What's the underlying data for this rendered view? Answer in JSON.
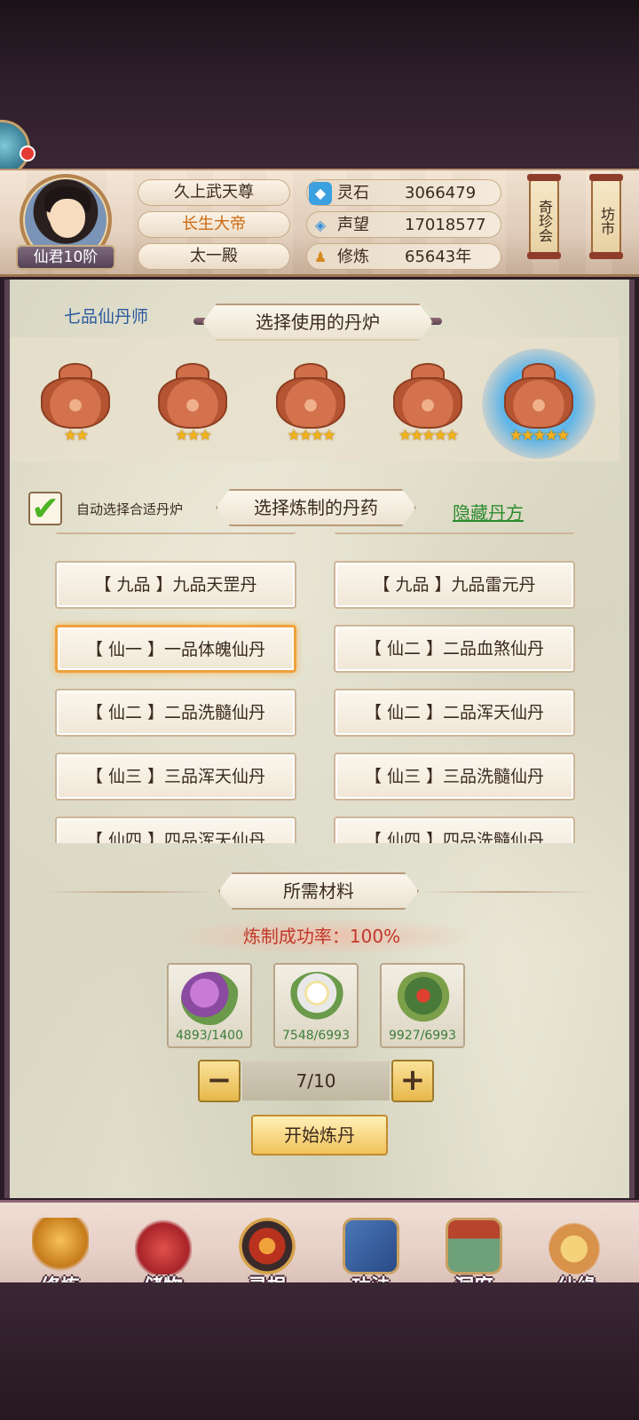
{
  "header": {
    "rank_badge": "仙君10阶",
    "titles": [
      "久上武天尊",
      "长生大帝",
      "太一殿"
    ],
    "stats": [
      {
        "icon": "spirit-stone-icon",
        "label": "灵石",
        "value": "3066479"
      },
      {
        "icon": "prestige-icon",
        "label": "声望",
        "value": "17018577"
      },
      {
        "icon": "cultivation-icon",
        "label": "修炼",
        "value": "65643年"
      }
    ],
    "lanterns": [
      "奇珍会",
      "坊市"
    ]
  },
  "panel": {
    "rank_title": "七品仙丹师",
    "furnace_banner": "选择使用的丹炉",
    "furnaces": [
      {
        "stars": "★★"
      },
      {
        "stars": "★★★"
      },
      {
        "stars": "★★★★"
      },
      {
        "stars": "★★★★★"
      },
      {
        "stars": "★★★★★"
      }
    ],
    "auto_select_label": "自动选择合适丹炉",
    "auto_select_checked": "✔",
    "pill_banner": "选择炼制的丹药",
    "hide_recipe": "隐藏丹方",
    "pills": [
      [
        "【 九品 】九品天罡丹",
        "【 九品 】九品雷元丹"
      ],
      [
        "【 仙一 】一品体魄仙丹",
        "【 仙二 】二品血煞仙丹"
      ],
      [
        "【 仙二 】二品洗髓仙丹",
        "【 仙二 】二品浑天仙丹"
      ],
      [
        "【 仙三 】三品浑天仙丹",
        "【 仙三 】三品洗髓仙丹"
      ],
      [
        "【 仙四 】四品浑天仙丹",
        "【 仙四 】四品洗髓仙丹"
      ]
    ],
    "materials_banner": "所需材料",
    "success_rate": "炼制成功率：100%",
    "materials": [
      {
        "icon": "purple-herb-icon",
        "count": "4893/1400"
      },
      {
        "icon": "white-lily-icon",
        "count": "7548/6993"
      },
      {
        "icon": "red-flower-herb-icon",
        "count": "9927/6993"
      }
    ],
    "quantity": "7/10",
    "minus": "−",
    "plus": "+",
    "start_button": "开始炼丹"
  },
  "nav": [
    {
      "label": "修炼",
      "icon": "cultivate-icon"
    },
    {
      "label": "储物",
      "icon": "storage-bag-icon"
    },
    {
      "label": "灵根",
      "icon": "spirit-root-icon"
    },
    {
      "label": "功法",
      "icon": "technique-book-icon"
    },
    {
      "label": "洞府",
      "icon": "cave-mansion-icon"
    },
    {
      "label": "仙缘",
      "icon": "immortal-fate-icon"
    }
  ]
}
